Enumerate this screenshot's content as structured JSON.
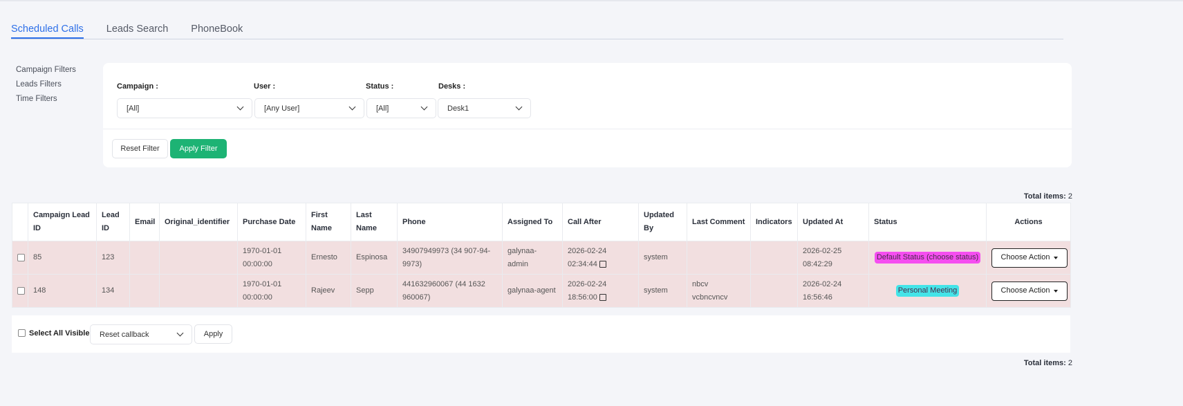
{
  "tabs": [
    "Scheduled Calls",
    "Leads Search",
    "PhoneBook"
  ],
  "side_filters": [
    "Campaign Filters",
    "Leads Filters",
    "Time Filters"
  ],
  "filters": {
    "campaign": {
      "label": "Campaign :",
      "value": "[All]"
    },
    "user": {
      "label": "User :",
      "value": "[Any User]"
    },
    "status": {
      "label": "Status :",
      "value": "[All]"
    },
    "desks": {
      "label": "Desks :",
      "value": "Desk1"
    },
    "reset_label": "Reset Filter",
    "apply_label": "Apply Filter"
  },
  "total": {
    "label": "Total items:",
    "value": "2"
  },
  "table": {
    "headers": [
      "Campaign Lead ID",
      "Lead ID",
      "Email",
      "Original_identifier",
      "Purchase Date",
      "First Name",
      "Last Name",
      "Phone",
      "Assigned To",
      "Call After",
      "Updated By",
      "Last Comment",
      "Indicators",
      "Updated At",
      "Status",
      "Actions"
    ],
    "rows": [
      {
        "campaign_lead_id": "85",
        "lead_id": "123",
        "email": "",
        "original_identifier": "",
        "purchase_date": "1970-01-01 00:00:00",
        "first_name": "Ernesto",
        "last_name": "Espinosa",
        "phone": "34907949973 (34 907-94-9973)",
        "assigned_to": "galynaa-admin",
        "call_after": "2026-02-24 02:34:44",
        "updated_by": "system",
        "last_comment": "",
        "indicators": "",
        "updated_at": "2026-02-25 08:42:29",
        "status": "Default Status (choose status)",
        "status_color": "#f54ef0",
        "action": "Choose Action"
      },
      {
        "campaign_lead_id": "148",
        "lead_id": "134",
        "email": "",
        "original_identifier": "",
        "purchase_date": "1970-01-01 00:00:00",
        "first_name": "Rajeev",
        "last_name": "Sepp",
        "phone": "441632960067 (44 1632 960067)",
        "assigned_to": "galynaa-agent",
        "call_after": "2026-02-24 18:56:00",
        "updated_by": "system",
        "last_comment": "nbcv vcbncvncv",
        "indicators": "",
        "updated_at": "2026-02-24 16:56:46",
        "status": "Personal Meeting",
        "status_color": "#44e4e8",
        "action": "Choose Action"
      }
    ]
  },
  "bulk": {
    "select_all_label": "Select All Visible",
    "action_value": "Reset callback",
    "apply_label": "Apply"
  }
}
